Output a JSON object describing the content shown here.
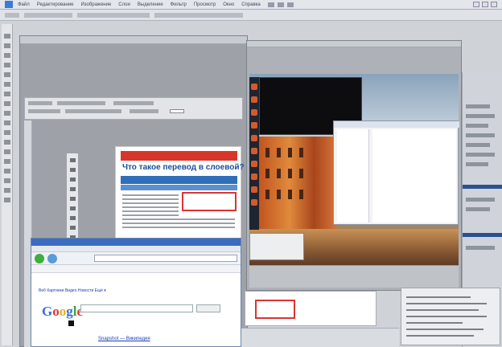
{
  "menu": {
    "items": [
      "Файл",
      "Редактирование",
      "Изображение",
      "Слои",
      "Выделение",
      "Фильтр",
      "Просмотр",
      "Окно",
      "Справка"
    ]
  },
  "page": {
    "title": "Что такое перевод в слоевой?"
  },
  "google": {
    "logo": [
      "G",
      "o",
      "o",
      "g",
      "l",
      "e"
    ],
    "tabs": "Веб   Картинки   Видео   Новости   Ещё ▾",
    "result": "Snapshot — Википедия"
  },
  "colors": {
    "accent": "#2f6fba",
    "headline": "#d9362b",
    "google_blue": "#3a6ed0"
  }
}
